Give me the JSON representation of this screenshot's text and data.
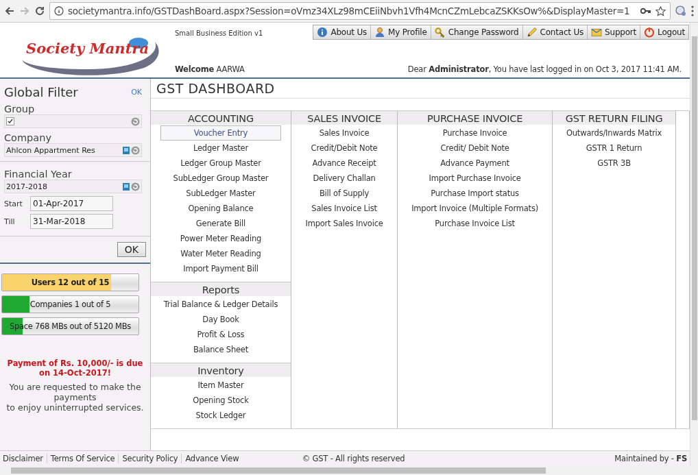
{
  "browser": {
    "url": "societymantra.info/GSTDashBoard.aspx?Session=oVmz34XLz98mCEiiNbvh1Vfh4McnCZmLebcaZSKKsOw%&DisplayMaster=1"
  },
  "header": {
    "edition": "Small Business Edition v1",
    "logo": "Society Mantra",
    "nav": [
      {
        "label": "About Us"
      },
      {
        "label": "My Profile"
      },
      {
        "label": "Change Password"
      },
      {
        "label": "Contact Us"
      },
      {
        "label": "Support"
      },
      {
        "label": "Logout"
      }
    ],
    "welcome": "**Welcome** AARWA",
    "login_message": "Dear **Administrator**, You have last logged in on Oct 3, 2017 11:41 AM."
  },
  "filter": {
    "title": "Global Filter",
    "ok_link": "OK",
    "group_label": "Group",
    "group_checked": true,
    "company_label": "Company",
    "company": "Ahlcon Appartment Res",
    "year_label": "Financial Year",
    "year": "2017-2018",
    "start_label": "Start",
    "start": "01-Apr-2017",
    "till_label": "Till",
    "till": "31-Mar-2018",
    "ok_button": "OK"
  },
  "usage": [
    {
      "label": "Users 12 out of 15",
      "level": 0.8,
      "color": "#f9d36b"
    },
    {
      "label": "Companies 1 out of 5",
      "level": 0.2,
      "color": "#1fa832"
    },
    {
      "label": "Space 768 MBs out of 5120 MBs",
      "level": 0.15,
      "color": "#1fa832"
    }
  ],
  "payment": {
    "alert": "Payment of Rs. 10,000/- is due on 14-Oct-2017!",
    "note": "You are requested to make the payments\nto enjoy uninterrupted services."
  },
  "page_title": "GST DASHBOARD",
  "menu": [
    {
      "sections": [
        {
          "title": "ACCOUNTING",
          "items": [
            {
              "label": "Voucher Entry",
              "selected": true
            },
            {
              "label": "Ledger Master",
              "selected": false
            },
            {
              "label": "Ledger Group Master",
              "selected": false
            },
            {
              "label": "SubLedger Group Master",
              "selected": false
            },
            {
              "label": "SubLedger Master",
              "selected": false
            },
            {
              "label": "Opening Balance",
              "selected": false
            },
            {
              "label": "Generate Bill",
              "selected": false
            },
            {
              "label": "Power Meter Reading",
              "selected": false
            },
            {
              "label": "Water Meter Reading",
              "selected": false
            },
            {
              "label": "Import Payment Bill",
              "selected": false
            }
          ]
        },
        {
          "title": "Reports",
          "items": [
            {
              "label": "Trial Balance & Ledger Details",
              "selected": false
            },
            {
              "label": "Day Book",
              "selected": false
            },
            {
              "label": "Profit & Loss",
              "selected": false
            },
            {
              "label": "Balance Sheet",
              "selected": false
            }
          ]
        },
        {
          "title": "Inventory",
          "items": [
            {
              "label": "Item Master",
              "selected": false
            },
            {
              "label": "Opening Stock",
              "selected": false
            },
            {
              "label": "Stock Ledger",
              "selected": false
            }
          ]
        }
      ]
    },
    {
      "sections": [
        {
          "title": "SALES INVOICE",
          "items": [
            {
              "label": "Sales Invoice",
              "selected": false
            },
            {
              "label": "Credit/Debit Note",
              "selected": false
            },
            {
              "label": "Advance Receipt",
              "selected": false
            },
            {
              "label": "Delivery Challan",
              "selected": false
            },
            {
              "label": "Bill of Supply",
              "selected": false
            },
            {
              "label": "Sales Invoice List",
              "selected": false
            },
            {
              "label": "Import Sales Invoice",
              "selected": false
            }
          ]
        }
      ]
    },
    {
      "sections": [
        {
          "title": "PURCHASE INVOICE",
          "items": [
            {
              "label": "Purchase Invoice",
              "selected": false
            },
            {
              "label": "Credit/ Debit Note",
              "selected": false
            },
            {
              "label": "Advance Payment",
              "selected": false
            },
            {
              "label": "Import Purchase Invoice",
              "selected": false
            },
            {
              "label": "Purchase Import status",
              "selected": false
            },
            {
              "label": "Import Invoice (Multiple Formats)",
              "selected": false
            },
            {
              "label": "Purchase Invoice List",
              "selected": false
            }
          ]
        }
      ]
    },
    {
      "sections": [
        {
          "title": "GST RETURN FILING",
          "items": [
            {
              "label": "Outwards/Inwards Matrix",
              "selected": false
            },
            {
              "label": "GSTR 1 Return",
              "selected": false
            },
            {
              "label": "GSTR 3B",
              "selected": false
            }
          ]
        }
      ]
    }
  ],
  "footer": {
    "links": [
      "Disclaimer",
      "Terms Of Service",
      "Security Policy",
      "Advance View"
    ],
    "copyright": "© GST - All rights reserved",
    "maintained": "Maintained by - **FS**"
  }
}
